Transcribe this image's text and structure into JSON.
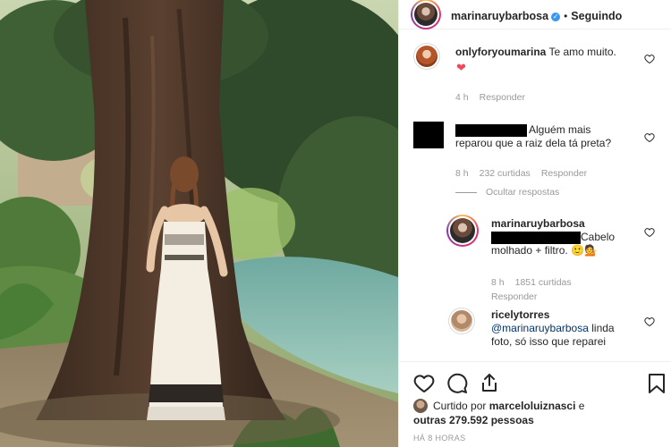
{
  "post": {
    "username": "marinaruybarbosa",
    "verified": true,
    "follow_state": "Seguindo",
    "separator": "•"
  },
  "comments": [
    {
      "username": "onlyforyoumarina",
      "text": "Te amo muito.",
      "emoji": "❤️",
      "time": "4 h",
      "reply_label": "Responder"
    },
    {
      "username": "",
      "username_redacted": true,
      "text_line1": "Alguém mais",
      "text_line2": "reparou que a raiz dela tá preta?",
      "time": "8 h",
      "likes": "232 curtidas",
      "reply_label": "Responder",
      "hide_replies": "Ocultar respostas"
    },
    {
      "username": "marinaruybarbosa",
      "mention_redacted": true,
      "text_line1": "Cabelo",
      "text_line2": "molhado + filtro.",
      "emoji": "🙂💁",
      "time": "8 h",
      "likes": "1851 curtidas",
      "reply_label": "Responder"
    },
    {
      "username": "ricelytorres",
      "mention": "@marinaruybarbosa",
      "text_line1_rest": " linda",
      "text_line2": "foto, só isso que reparei"
    }
  ],
  "footer": {
    "liked_by_prefix": "Curtido por",
    "liked_by_user": "marceloluiznasci",
    "liked_by_suffix": "e",
    "others": "outras 279.592 pessoas",
    "time_ago": "HÁ 8 HORAS"
  },
  "icons": {
    "like": "heart-outline-icon",
    "comment": "comment-bubble-icon",
    "share": "share-icon",
    "save": "bookmark-icon"
  },
  "colors": {
    "verified": "#3897f0",
    "muted": "#999999",
    "text": "#262626",
    "mention": "#003569"
  }
}
